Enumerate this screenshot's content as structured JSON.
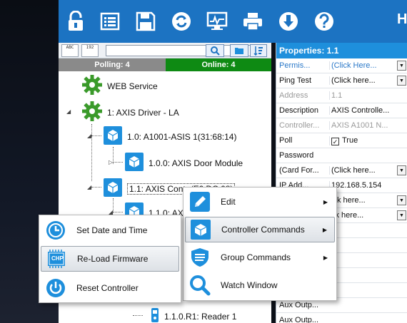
{
  "toolbar": {
    "title": "H",
    "buttons": [
      "lock-icon",
      "list-icon",
      "save-icon",
      "refresh-icon",
      "monitor-icon",
      "print-icon",
      "download-icon",
      "help-icon"
    ]
  },
  "tree": {
    "sort_alpha": "ABC",
    "sort_numeric": "192",
    "search_value": "",
    "polling": "Polling: 4",
    "online": "Online: 4",
    "nodes": {
      "web_service": "WEB Service",
      "driver": "1:  AXIS Driver - LA",
      "controller_1_0": "1.0:  A1001-ASIS 1(31:68:14)",
      "door_module": "1.0.0:  AXIS Door Module",
      "controller_1_1": "1.1:  AXIS Contr",
      "controller_1_1_partial": "(F6:DC:08)",
      "door_1_1_0": "1.1.0:  AX",
      "reader": "1.1.0.R1:  Reader 1"
    }
  },
  "properties": {
    "title": "Properties:  1.1",
    "rows": [
      {
        "name": "Permis...",
        "value": "(Click Here...",
        "name_color": "blue",
        "value_color": "blue",
        "dropdown": true
      },
      {
        "name": "Ping Test",
        "value": "(Click here...",
        "dropdown": true
      },
      {
        "name": "Address",
        "value": "1.1",
        "name_color": "gray",
        "value_color": "gray"
      },
      {
        "name": "Description",
        "value": "AXIS Controlle..."
      },
      {
        "name": "Controller...",
        "value": "AXIS A1001 N...",
        "name_color": "gray",
        "value_color": "gray"
      },
      {
        "name": "Poll",
        "value": "True",
        "checkbox": true
      },
      {
        "name": "Password",
        "value": ""
      },
      {
        "name": "(Card For...",
        "value": "(Click here...",
        "dropdown": true
      },
      {
        "name": "IP Add...",
        "value": "192.168.5.154"
      },
      {
        "name": "",
        "value": "ick here...",
        "dropdown": true
      },
      {
        "name": "",
        "value": "ck here...",
        "dropdown": true
      },
      {
        "name": "",
        "value": ""
      },
      {
        "name": "",
        "value": ""
      },
      {
        "name": "",
        "value": ""
      },
      {
        "name": "",
        "value": ""
      },
      {
        "name": "",
        "value": ""
      },
      {
        "name": "Aux Outp...",
        "value": ""
      },
      {
        "name": "Aux Outp...",
        "value": ""
      }
    ]
  },
  "context_menu": {
    "items": [
      {
        "label": "Edit",
        "icon": "edit-icon",
        "submenu": true
      },
      {
        "label": "Controller Commands",
        "icon": "controller-icon",
        "submenu": true
      },
      {
        "label": "Group Commands",
        "icon": "shield-icon",
        "submenu": true
      },
      {
        "label": "Watch Window",
        "icon": "magnifier-icon",
        "submenu": false
      }
    ]
  },
  "submenu": {
    "items": [
      {
        "label": "Set Date and Time",
        "icon": "clock-icon"
      },
      {
        "label": "Re-Load Firmware",
        "icon": "chip-icon",
        "chip_text": "CHP"
      },
      {
        "label": "Reset Controller",
        "icon": "power-icon"
      }
    ]
  },
  "colors": {
    "toolbar": "#1c73c2",
    "properties_header": "#1e8fdc",
    "online": "#0e8a13",
    "polling": "#8a8a8a",
    "gear": "#3a9a2a",
    "device": "#1e8fdc"
  }
}
